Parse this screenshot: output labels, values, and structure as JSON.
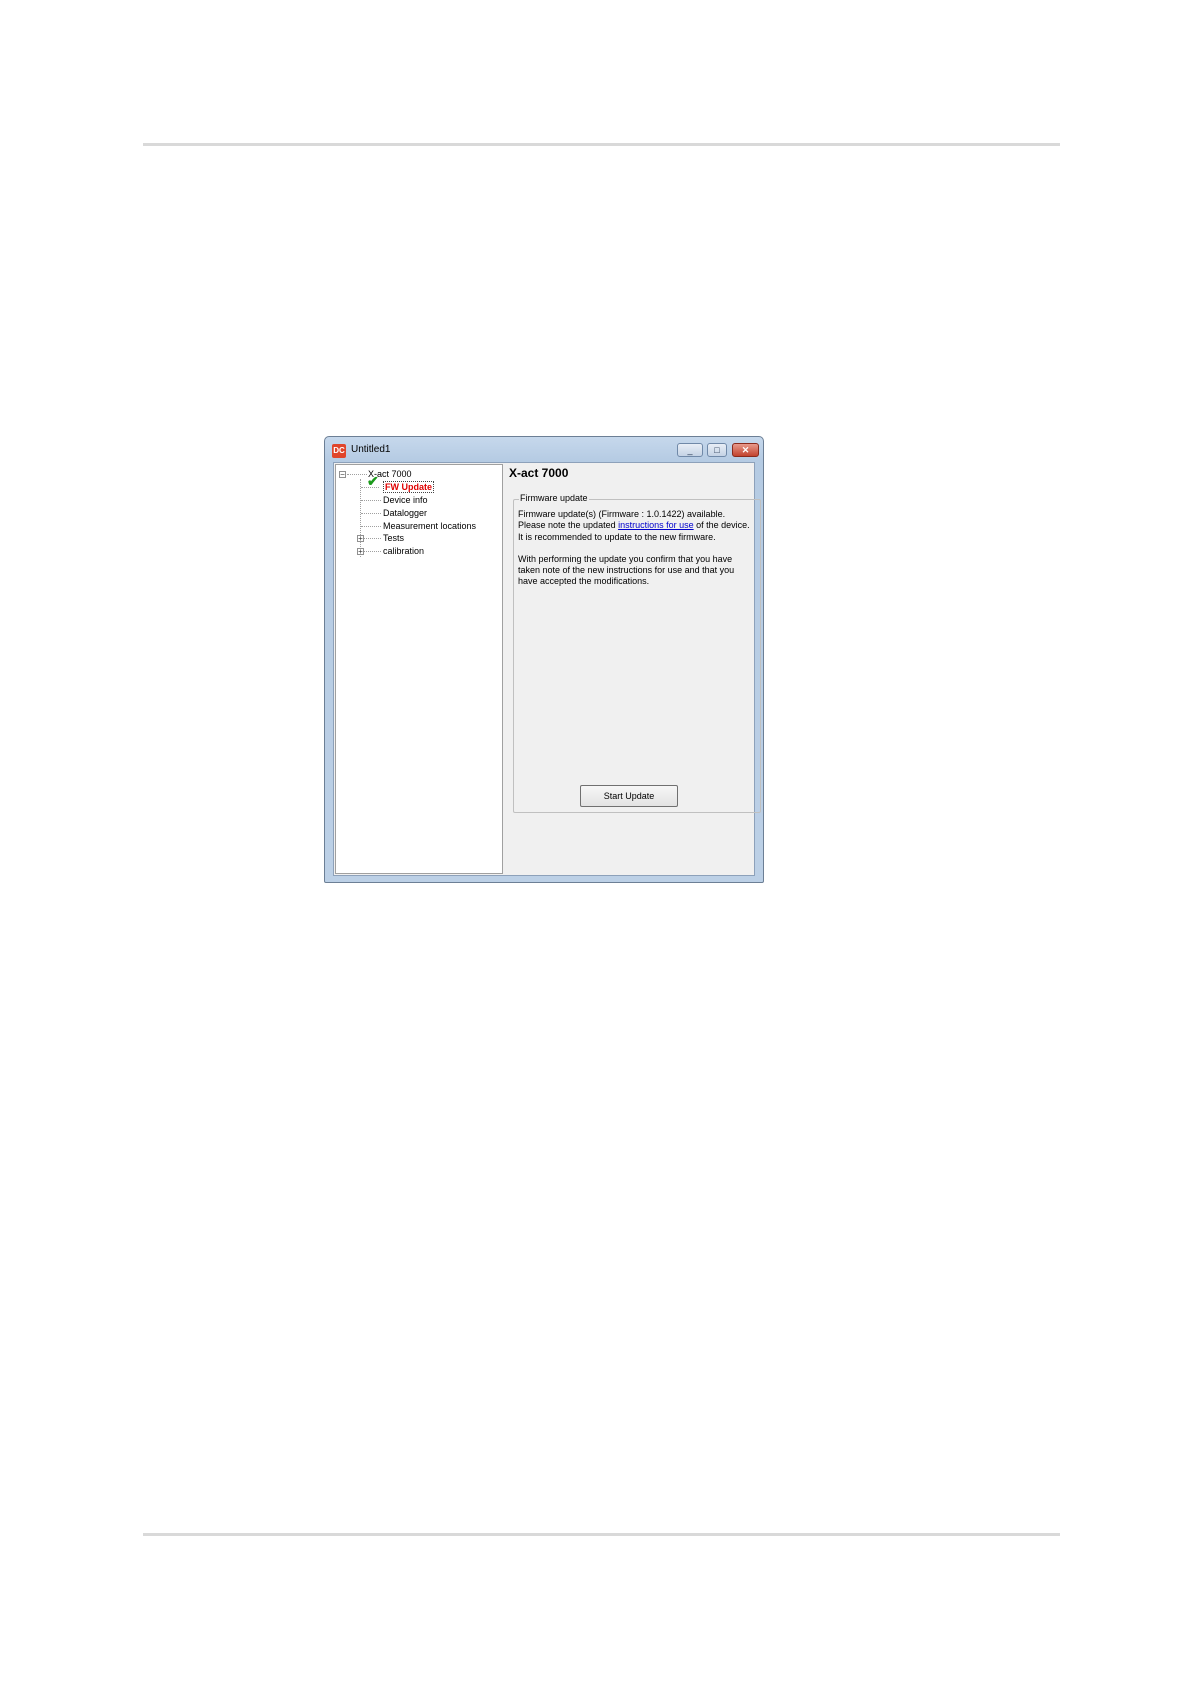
{
  "window": {
    "app_icon_text": "DC",
    "title": "Untitled1",
    "minimize_glyph": "_",
    "maximize_glyph": "□",
    "close_glyph": "✕"
  },
  "tree": {
    "root": "X-act 7000",
    "items": [
      {
        "label": "FW Update"
      },
      {
        "label": "Device info"
      },
      {
        "label": "Datalogger"
      },
      {
        "label": "Measurement locations"
      },
      {
        "label": "Tests"
      },
      {
        "label": "calibration"
      }
    ],
    "collapse_glyph": "−",
    "expand_glyph": "+"
  },
  "panel": {
    "device_title": "X-act 7000",
    "group_title": "Firmware update",
    "line1": "Firmware update(s) (Firmware : 1.0.1422) available.",
    "line2_pre": "Please note the updated ",
    "line2_link": "instructions for use",
    "line2_post": " of the device.",
    "line3": "It is recommended to update to the new firmware.",
    "para2": "With performing the update you confirm that you have taken note of the new instructions for use and that you have accepted the modifications.",
    "start_button": "Start Update"
  },
  "icons": {
    "checkmark": "checkmark-icon",
    "accent_color": "#e00000",
    "check_color": "#1b9a1b"
  }
}
